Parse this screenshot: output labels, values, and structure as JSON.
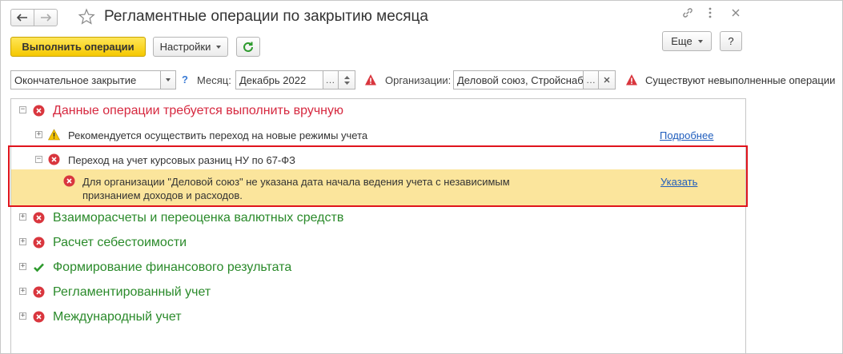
{
  "window": {
    "title": "Регламентные операции по закрытию месяца"
  },
  "header": {
    "icons": [
      "arrow-left-icon",
      "arrow-right-icon",
      "star-icon",
      "link-icon",
      "more-icon",
      "close-icon"
    ]
  },
  "toolbar": {
    "run_label": "Выполнить операции",
    "settings_label": "Настройки",
    "more_label": "Еще",
    "help_label": "?"
  },
  "filters": {
    "mode_value": "Окончательное закрытие",
    "mode_help": "?",
    "month_label": "Месяц:",
    "month_value": "Декабрь 2022",
    "org_label": "Организации:",
    "org_value": "Деловой союз, Стройснаб",
    "warning_text": "Существуют невыполненные операции"
  },
  "tree": {
    "manual_group": {
      "label": "Данные операции требуется выполнить вручную",
      "items": [
        {
          "label": "Рекомендуется осуществить переход на новые режимы учета",
          "link": "Подробнее"
        },
        {
          "label": "Переход на учет курсовых разниц НУ по 67-ФЗ",
          "detail_line1": "Для организации \"Деловой союз\" не указана дата начала ведения учета с независимым",
          "detail_line2": "признанием доходов и расходов.",
          "detail_link": "Указать"
        }
      ]
    },
    "groups": [
      {
        "label": "Взаиморасчеты и переоценка валютных средств",
        "status": "error"
      },
      {
        "label": "Расчет себестоимости",
        "status": "error"
      },
      {
        "label": "Формирование финансового результата",
        "status": "ok"
      },
      {
        "label": "Регламентированный учет",
        "status": "error"
      },
      {
        "label": "Международный учет",
        "status": "error"
      }
    ]
  },
  "colors": {
    "accent_yellow": "#f5c800",
    "error_red": "#d6283f",
    "success_green": "#2a8a2a",
    "highlight": "#fbe59c",
    "frame_red": "#e0141c",
    "link_blue": "#1f5dbd"
  }
}
